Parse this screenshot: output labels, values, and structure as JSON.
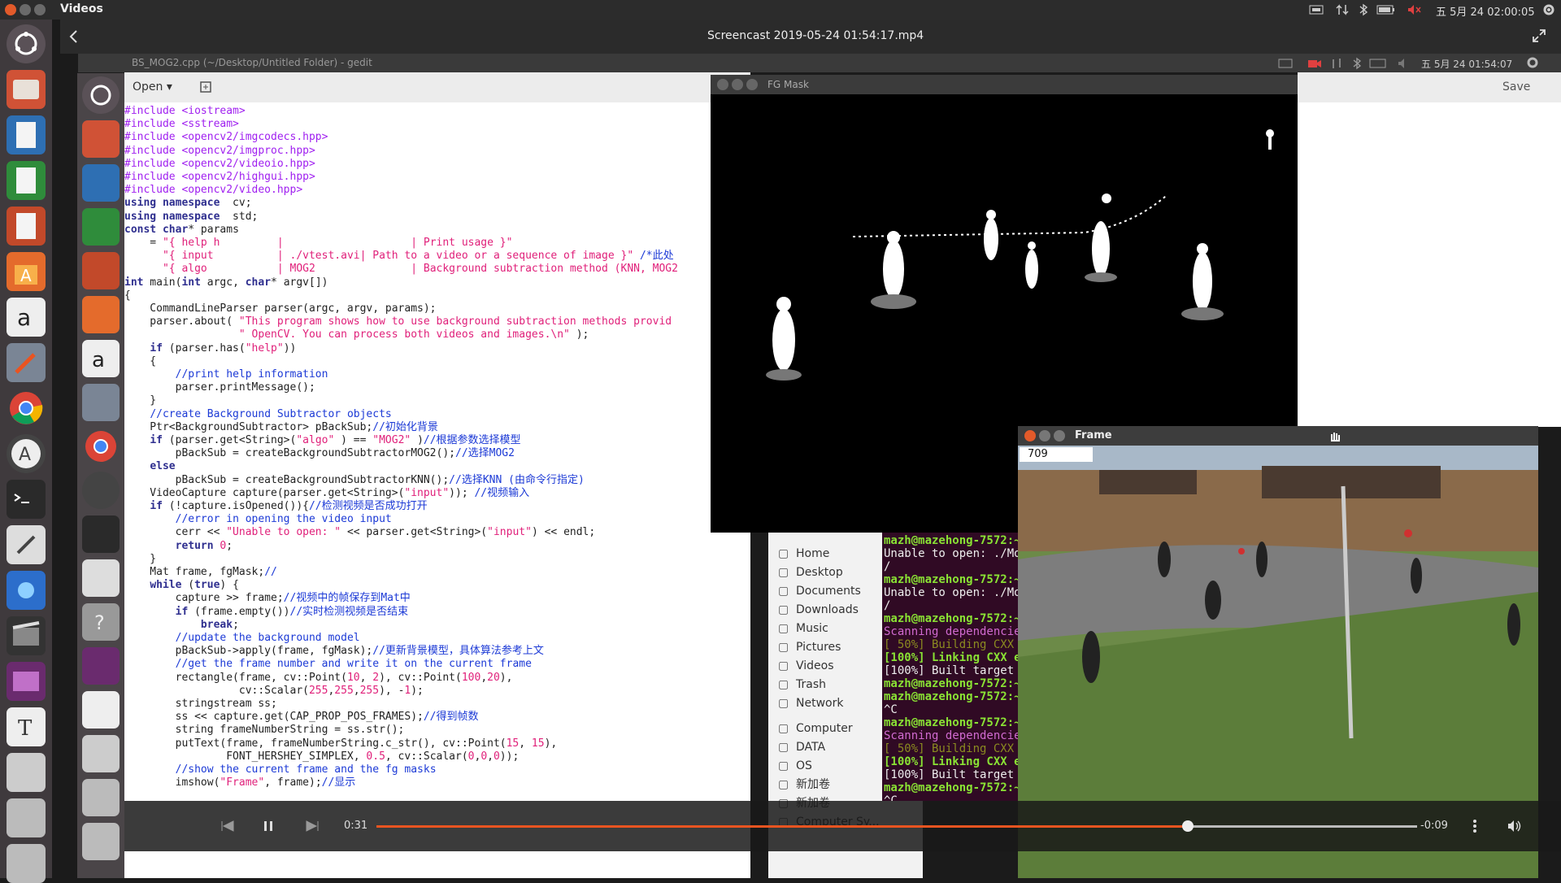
{
  "topbar": {
    "app_title": "Videos",
    "clock": "五 5月 24 02:00:05"
  },
  "header": {
    "video_title": "Screencast 2019-05-24 01:54:17.mp4"
  },
  "inner": {
    "gedit_title": "BS_MOG2.cpp (~/Desktop/Untitled Folder) - gedit",
    "clock": "五 5月 24 01:54:07"
  },
  "gedit": {
    "open_label": "Open",
    "save_label": "Save"
  },
  "code_lines": [
    [
      [
        "pp",
        "#include <iostream>"
      ]
    ],
    [
      [
        "pp",
        "#include <sstream>"
      ]
    ],
    [
      [
        "pp",
        "#include <opencv2/imgcodecs.hpp>"
      ]
    ],
    [
      [
        "pp",
        "#include <opencv2/imgproc.hpp>"
      ]
    ],
    [
      [
        "pp",
        "#include <opencv2/videoio.hpp>"
      ]
    ],
    [
      [
        "pp",
        "#include <opencv2/highgui.hpp>"
      ]
    ],
    [
      [
        "pp",
        "#include <opencv2/video.hpp>"
      ]
    ],
    [
      [
        "kw",
        "using namespace"
      ],
      [
        "",
        "  cv;"
      ]
    ],
    [
      [
        "kw",
        "using namespace"
      ],
      [
        "",
        "  std;"
      ]
    ],
    [
      [
        "kw",
        "const char"
      ],
      [
        "",
        "* params"
      ]
    ],
    [
      [
        "",
        "    = "
      ],
      [
        "str",
        "\"{ help h         |                    | Print usage }\""
      ]
    ],
    [
      [
        "",
        "      "
      ],
      [
        "str",
        "\"{ input          | ./vtest.avi| Path to a video or a sequence of image }\""
      ],
      [
        "cm",
        " /*此处"
      ]
    ],
    [
      [
        "",
        "      "
      ],
      [
        "str",
        "\"{ algo           | MOG2               | Background subtraction method (KNN, MOG2"
      ]
    ],
    [
      [
        "kw",
        "int"
      ],
      [
        "",
        " main("
      ],
      [
        "kw",
        "int"
      ],
      [
        "",
        " argc, "
      ],
      [
        "kw",
        "char"
      ],
      [
        "",
        "* argv[])"
      ]
    ],
    [
      [
        "",
        "{"
      ]
    ],
    [
      [
        "",
        "    CommandLineParser parser(argc, argv, params);"
      ]
    ],
    [
      [
        "",
        "    parser.about( "
      ],
      [
        "str",
        "\"This program shows how to use background subtraction methods provid"
      ]
    ],
    [
      [
        "",
        "                  "
      ],
      [
        "str",
        "\" OpenCV. You can process both videos and images.\\n\""
      ],
      [
        "",
        " );"
      ]
    ],
    [
      [
        "",
        "    "
      ],
      [
        "kw",
        "if"
      ],
      [
        "",
        " (parser.has("
      ],
      [
        "str",
        "\"help\""
      ],
      [
        "",
        "))"
      ]
    ],
    [
      [
        "",
        "    {"
      ]
    ],
    [
      [
        "",
        "        "
      ],
      [
        "cm",
        "//print help information"
      ]
    ],
    [
      [
        "",
        "        parser.printMessage();"
      ]
    ],
    [
      [
        "",
        "    }"
      ]
    ],
    [
      [
        "",
        "    "
      ],
      [
        "cm",
        "//create Background Subtractor objects"
      ]
    ],
    [
      [
        "",
        "    Ptr<BackgroundSubtractor> pBackSub;"
      ],
      [
        "cm",
        "//初始化背景"
      ]
    ],
    [
      [
        "",
        "    "
      ],
      [
        "kw",
        "if"
      ],
      [
        "",
        " (parser.get<String>("
      ],
      [
        "str",
        "\"algo\""
      ],
      [
        "",
        " ) == "
      ],
      [
        "str",
        "\"MOG2\""
      ],
      [
        "",
        " )"
      ],
      [
        "cm",
        "//根据参数选择模型"
      ]
    ],
    [
      [
        "",
        "        pBackSub = createBackgroundSubtractorMOG2();"
      ],
      [
        "cm",
        "//选择MOG2"
      ]
    ],
    [
      [
        "",
        "    "
      ],
      [
        "kw",
        "else"
      ]
    ],
    [
      [
        "",
        "        pBackSub = createBackgroundSubtractorKNN();"
      ],
      [
        "cm",
        "//选择KNN (由命令行指定)"
      ]
    ],
    [
      [
        "",
        "    VideoCapture capture(parser.get<String>("
      ],
      [
        "str",
        "\"input\""
      ],
      [
        "",
        ")); "
      ],
      [
        "cm",
        "//视频输入"
      ]
    ],
    [
      [
        "",
        "    "
      ],
      [
        "kw",
        "if"
      ],
      [
        "",
        " (!capture.isOpened()){"
      ],
      [
        "cm",
        "//检测视频是否成功打开"
      ]
    ],
    [
      [
        "",
        "        "
      ],
      [
        "cm",
        "//error in opening the video input"
      ]
    ],
    [
      [
        "",
        "        cerr << "
      ],
      [
        "str",
        "\"Unable to open: \""
      ],
      [
        "",
        " << parser.get<String>("
      ],
      [
        "str",
        "\"input\""
      ],
      [
        "",
        ") << endl;"
      ]
    ],
    [
      [
        "",
        "        "
      ],
      [
        "kw",
        "return"
      ],
      [
        "",
        " "
      ],
      [
        "num",
        "0"
      ],
      [
        "",
        ";"
      ]
    ],
    [
      [
        "",
        "    }"
      ]
    ],
    [
      [
        "",
        "    Mat frame, fgMask;"
      ],
      [
        "cm",
        "//"
      ]
    ],
    [
      [
        "",
        "    "
      ],
      [
        "kw",
        "while"
      ],
      [
        "",
        " ("
      ],
      [
        "kw",
        "true"
      ],
      [
        "",
        ") {"
      ]
    ],
    [
      [
        "",
        "        capture >> frame;"
      ],
      [
        "cm",
        "//视频中的帧保存到Mat中"
      ]
    ],
    [
      [
        "",
        "        "
      ],
      [
        "kw",
        "if"
      ],
      [
        "",
        " (frame.empty())"
      ],
      [
        "cm",
        "//实时检测视频是否结束"
      ]
    ],
    [
      [
        "",
        "            "
      ],
      [
        "kw",
        "break"
      ],
      [
        "",
        ";"
      ]
    ],
    [
      [
        "",
        "        "
      ],
      [
        "cm",
        "//update the background model"
      ]
    ],
    [
      [
        "",
        "        pBackSub->apply(frame, fgMask);"
      ],
      [
        "cm",
        "//更新背景模型，具体算法参考上文"
      ]
    ],
    [
      [
        "",
        "        "
      ],
      [
        "cm",
        "//get the frame number and write it on the current frame"
      ]
    ],
    [
      [
        "",
        "        rectangle(frame, cv::Point("
      ],
      [
        "num",
        "10"
      ],
      [
        "",
        ", "
      ],
      [
        "num",
        "2"
      ],
      [
        "",
        "), cv::Point("
      ],
      [
        "num",
        "100"
      ],
      [
        "",
        ","
      ],
      [
        "num",
        "20"
      ],
      [
        "",
        "),"
      ]
    ],
    [
      [
        "",
        "                  cv::Scalar("
      ],
      [
        "num",
        "255"
      ],
      [
        "",
        ","
      ],
      [
        "num",
        "255"
      ],
      [
        "",
        ","
      ],
      [
        "num",
        "255"
      ],
      [
        "",
        "), -"
      ],
      [
        "num",
        "1"
      ],
      [
        "",
        ");"
      ]
    ],
    [
      [
        "",
        "        stringstream ss;"
      ]
    ],
    [
      [
        "",
        "        ss << capture.get(CAP_PROP_POS_FRAMES);"
      ],
      [
        "cm",
        "//得到帧数"
      ]
    ],
    [
      [
        "",
        "        string frameNumberString = ss.str();"
      ]
    ],
    [
      [
        "",
        "        putText(frame, frameNumberString.c_str(), cv::Point("
      ],
      [
        "num",
        "15"
      ],
      [
        "",
        ", "
      ],
      [
        "num",
        "15"
      ],
      [
        "",
        "),"
      ]
    ],
    [
      [
        "",
        "                FONT_HERSHEY_SIMPLEX, "
      ],
      [
        "num",
        "0.5"
      ],
      [
        "",
        ", cv::Scalar("
      ],
      [
        "num",
        "0"
      ],
      [
        "",
        ","
      ],
      [
        "num",
        "0"
      ],
      [
        "",
        ","
      ],
      [
        "num",
        "0"
      ],
      [
        "",
        "));"
      ]
    ],
    [
      [
        "",
        "        "
      ],
      [
        "cm",
        "//show the current frame and the fg masks"
      ]
    ],
    [
      [
        "",
        "        imshow("
      ],
      [
        "str",
        "\"Frame\""
      ],
      [
        "",
        ", frame);"
      ],
      [
        "cm",
        "//显示"
      ]
    ]
  ],
  "fg_window_title": "FG Mask",
  "frame_window_title": "Frame",
  "frame_number": "709",
  "nautilus_items": [
    "Home",
    "Desktop",
    "Documents",
    "Downloads",
    "Music",
    "Pictures",
    "Videos",
    "Trash",
    "Network",
    "Computer",
    "DATA",
    "OS",
    "新加卷",
    "新加卷",
    "Computer Sy..."
  ],
  "terminal_lines": [
    [
      "u",
      "mazh@mazehong-7572:~"
    ],
    [
      "w",
      "Unable to open: ./Mo"
    ],
    [
      "w",
      "/"
    ],
    [
      "u",
      "mazh@mazehong-7572:~"
    ],
    [
      "w",
      "Unable to open: ./Mo"
    ],
    [
      "w",
      "/"
    ],
    [
      "u",
      "mazh@mazehong-7572:~"
    ],
    [
      "m",
      "Scanning dependencie"
    ],
    [
      "b",
      "[ 50%] Building CXX"
    ],
    [
      "g",
      "[100%] Linking CXX e"
    ],
    [
      "w",
      "[100%] Built target"
    ],
    [
      "u",
      "mazh@mazehong-7572:~"
    ],
    [
      "u",
      "mazh@mazehong-7572:~"
    ],
    [
      "w",
      "^C"
    ],
    [
      "u",
      "mazh@mazehong-7572:~"
    ],
    [
      "m",
      "Scanning dependencie"
    ],
    [
      "b",
      "[ 50%] Building CXX"
    ],
    [
      "g",
      "[100%] Linking CXX e"
    ],
    [
      "w",
      "[100%] Built target"
    ],
    [
      "u",
      "mazh@mazehong-7572:~"
    ],
    [
      "w",
      "^C"
    ]
  ],
  "player": {
    "elapsed": "0:31",
    "remaining": "-0:09",
    "progress": 0.78
  },
  "colors": {
    "accent": "#e95420",
    "terminal_bg": "#300a24"
  }
}
